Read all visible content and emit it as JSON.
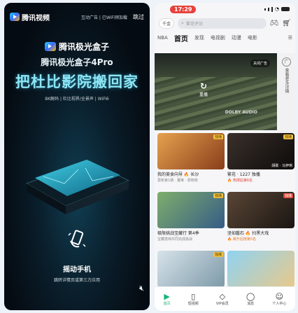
{
  "left": {
    "brand": "腾讯视频",
    "ad_flags": "互动广告 | 已WiFi预加载",
    "skip": "跳过",
    "product_name": "腾讯极光盒子",
    "model": "腾讯极光盒子4Pro",
    "slogan": "把杜比影院搬回家",
    "specs": "8K解码 | 杜比视界/全景声 | WiFi6",
    "shake_title": "摇动手机",
    "shake_sub": "跳转详情页或第三方应用",
    "mute_icon": "mute-icon"
  },
  "right": {
    "status": {
      "time": "17:29"
    },
    "search": {
      "pill": "千金",
      "placeholder": "繁花评论"
    },
    "tabs": [
      "NBA",
      "首页",
      "发现",
      "电视剧",
      "动漫",
      "电影"
    ],
    "hero": {
      "close_ad": "关闭广告",
      "replay": "重播",
      "dolby": "DOLBY AUDIO",
      "side": "查看更多详情"
    },
    "cards": [
      {
        "title": "我的美食向导 🔥 长沙",
        "sub": "更新第1期 · 董琳 · 郭晓晓",
        "badge": "独播",
        "caption": "",
        "color": "#c9772c"
      },
      {
        "title": "繁花 · 1227 独播",
        "sub": "🔥 热搜后第6名",
        "badge": "独播",
        "caption": "胡歌 · 马伊琍",
        "color": "#2b2320"
      },
      {
        "title": "极限挑战宝藏行 第4季",
        "sub": "宝藏搭档共同完成挑战",
        "badge": "独播",
        "caption": "",
        "color": "#6b8b57"
      },
      {
        "title": "坚如磐石 🔥 扫黑大戏",
        "sub": "🔥 飙升后榜第5名",
        "badge": "独播",
        "caption": "",
        "color": "#3a2b24"
      },
      {
        "title": "",
        "sub": "",
        "badge": "独播",
        "caption": "",
        "color": "#a7c0cf"
      },
      {
        "title": "",
        "sub": "",
        "badge": "",
        "caption": "",
        "color": "#6cbde3"
      }
    ],
    "nav": [
      "首页",
      "短视频",
      "VIP会员",
      "消息",
      "个人中心"
    ]
  }
}
